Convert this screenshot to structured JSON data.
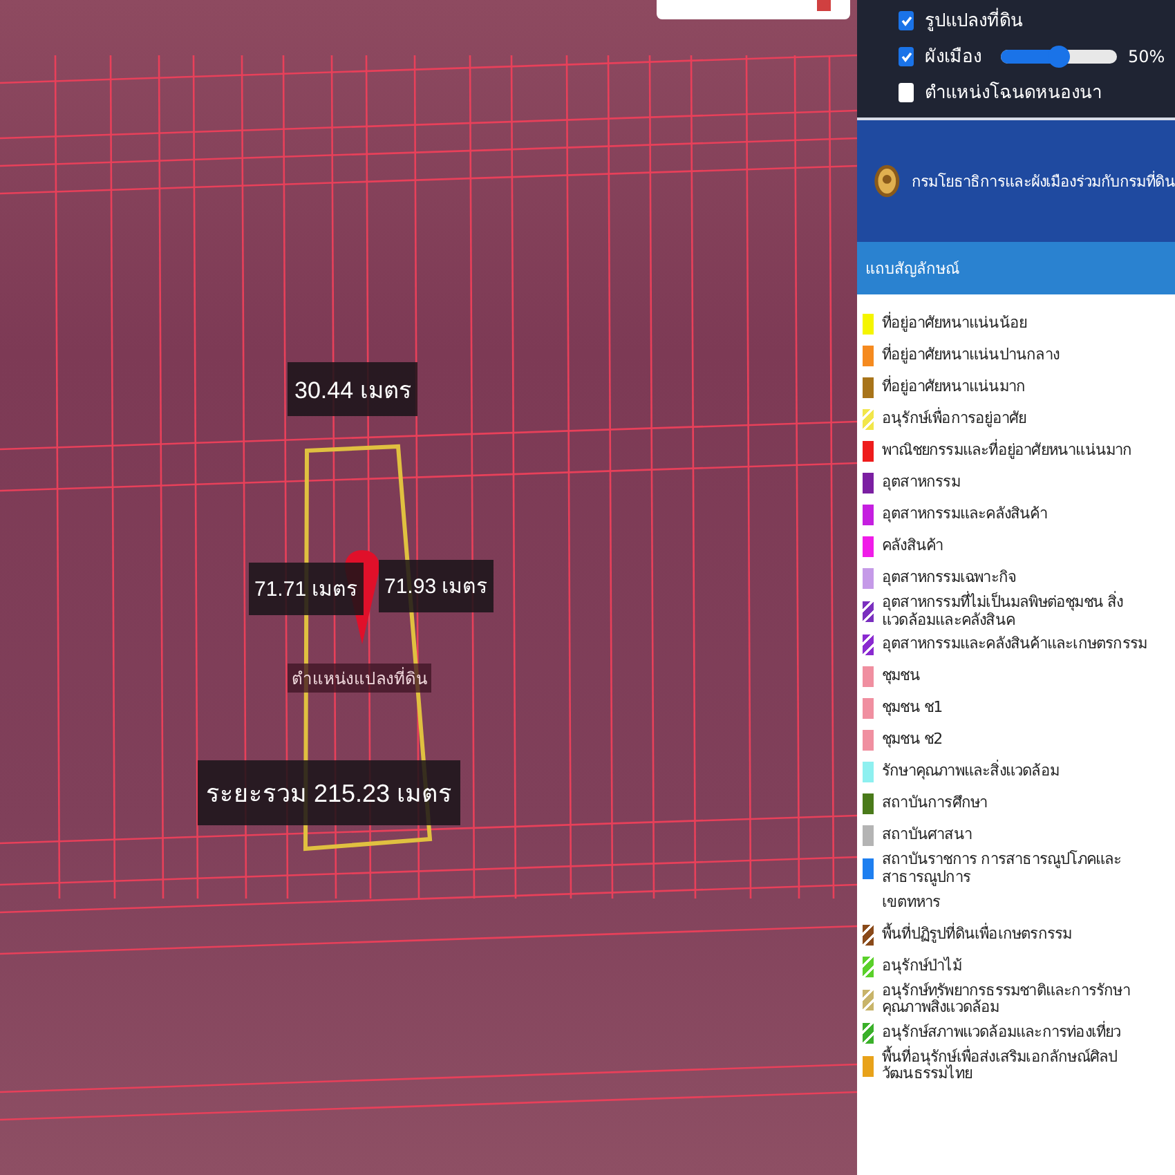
{
  "layers": [
    {
      "label": "รูปแปลงที่ดิน",
      "checked": true
    },
    {
      "label": "ผังเมือง",
      "checked": true,
      "slider": {
        "level": 0.5,
        "reading": "50%"
      }
    },
    {
      "label": "ตำแหน่งโฉนดหนองนา",
      "checked": false
    }
  ],
  "agency": {
    "title": "กรมโยธาธิการและผังเมืองร่วมกับกรมที่ดิน"
  },
  "legend": {
    "title": "แถบสัญลักษณ์",
    "items": [
      {
        "label": "ที่อยู่อาศัยหนาแน่นน้อย",
        "kind": "solid",
        "color": "#f5f500"
      },
      {
        "label": "ที่อยู่อาศัยหนาแน่นปานกลาง",
        "kind": "solid",
        "color": "#f58a1f"
      },
      {
        "label": "ที่อยู่อาศัยหนาแน่นมาก",
        "kind": "solid",
        "color": "#a8741a"
      },
      {
        "label": "อนุรักษ์เพื่อการอยู่อาศัย",
        "kind": "hatched",
        "color": "#f2e64a"
      },
      {
        "label": "พาณิชยกรรมและที่อยู่อาศัยหนาแน่นมาก",
        "kind": "solid",
        "color": "#ee1c1c"
      },
      {
        "label": "อุตสาหกรรม",
        "kind": "solid",
        "color": "#7b1fa2"
      },
      {
        "label": "อุตสาหกรรมและคลังสินค้า",
        "kind": "solid",
        "color": "#c51fe0"
      },
      {
        "label": "คลังสินค้า",
        "kind": "solid",
        "color": "#f01ce8"
      },
      {
        "label": "อุตสาหกรรมเฉพาะกิจ",
        "kind": "solid",
        "color": "#c59ae8"
      },
      {
        "label": "อุตสาหกรรมที่ไม่เป็นมลพิษต่อชุมชน สิ่งแวดล้อมและคลังสินค",
        "kind": "hatched",
        "color": "#7a2fbf"
      },
      {
        "label": "อุตสาหกรรมและคลังสินค้าและเกษตรกรรม",
        "kind": "hatched",
        "color": "#8a2ad0"
      },
      {
        "label": "ชุมชน",
        "kind": "solid",
        "color": "#f08fa0"
      },
      {
        "label": "ชุมชน ช1",
        "kind": "solid",
        "color": "#f08fa0"
      },
      {
        "label": "ชุมชน ช2",
        "kind": "solid",
        "color": "#f08fa0"
      },
      {
        "label": "รักษาคุณภาพและสิ่งแวดล้อม",
        "kind": "solid",
        "color": "#8ef0f0"
      },
      {
        "label": "สถาบันการศึกษา",
        "kind": "solid",
        "color": "#4a7a1a"
      },
      {
        "label": "สถาบันศาสนา",
        "kind": "solid",
        "color": "#b4b4b4"
      },
      {
        "label": "สถาบันราชการ การสาธารณูปโภคและสาธารณูปการ",
        "kind": "solid",
        "color": "#1e7ff0"
      },
      {
        "label": "เขตทหาร",
        "kind": "none"
      },
      {
        "label": "พื้นที่ปฏิรูปที่ดินเพื่อเกษตรกรรม",
        "kind": "hatched",
        "color": "#8a4a1a"
      },
      {
        "label": "อนุรักษ์ป่าไม้",
        "kind": "hatched",
        "color": "#5ad02a"
      },
      {
        "label": "อนุรักษ์ทรัพยากรธรรมชาติและการรักษาคุณภาพสิ่งแวดล้อม",
        "kind": "hatched",
        "color": "#c8b46a"
      },
      {
        "label": "อนุรักษ์สภาพแวดล้อมและการท่องเที่ยว",
        "kind": "hatched",
        "color": "#3ab02a"
      },
      {
        "label": "พื้นที่อนุรักษ์เพื่อส่งเสริมเอกลักษณ์ศิลปวัฒนธรรมไทย",
        "kind": "solid",
        "color": "#e8a21a"
      }
    ]
  },
  "map": {
    "measurements": [
      {
        "label": "30.44 เมตร"
      },
      {
        "label": "71.71 เมตร"
      },
      {
        "label": "71.93 เมตร"
      },
      {
        "label": "ระยะรวม 215.23 เมตร"
      }
    ],
    "marker": {
      "label": "ตำแหน่งแปลงที่ดิน"
    }
  }
}
